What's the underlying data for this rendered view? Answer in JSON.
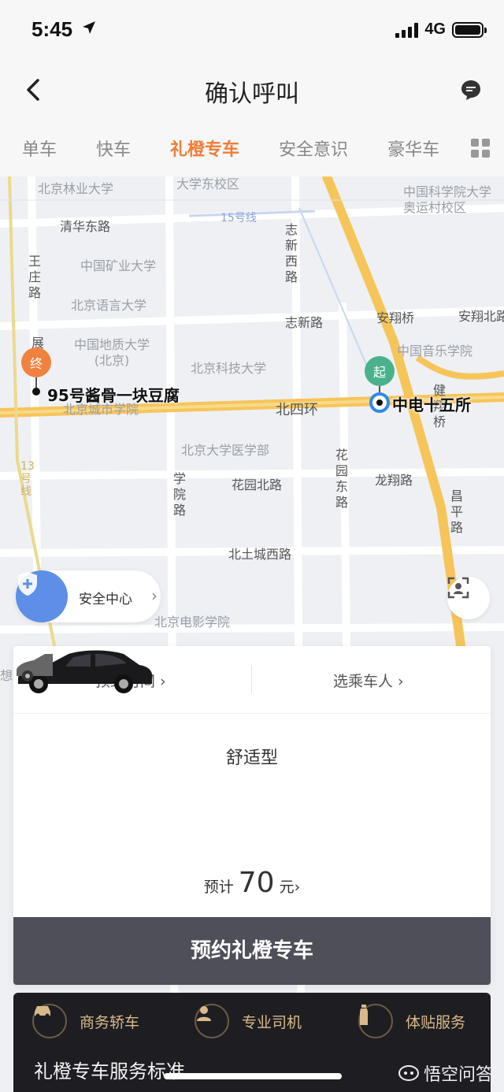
{
  "status_bar": {
    "time": "5:45",
    "network": "4G"
  },
  "header": {
    "title": "确认呼叫"
  },
  "tabs": [
    {
      "label": "单车"
    },
    {
      "label": "快车"
    },
    {
      "label": "礼橙专车"
    },
    {
      "label": "安全意识"
    },
    {
      "label": "豪华车"
    }
  ],
  "map": {
    "labels": {
      "bjly": "北京林业大学",
      "dxdx": "大学东校区",
      "zgkx": "中国科学院大学奥运村校区",
      "qhdl": "清华东路",
      "line15": "15号线",
      "zxxl": "志新西路",
      "wzl": "王庄路",
      "kydx": "中国矿业大学",
      "yydx": "北京语言大学",
      "zxl": "志新路",
      "axq": "安翔桥",
      "axbl": "安翔北路",
      "dzdx": "中国地质大学(北京)",
      "kjdx": "北京科技大学",
      "yyxy": "中国音乐学院",
      "zhan": "展",
      "csxy": "北京城市学院",
      "bsh": "北四环",
      "jxq": "健翔桥",
      "ykb": "北京大学医学部",
      "hydl": "花园东路",
      "line13": "13号线",
      "xyl": "学院路",
      "hybl": "花园北路",
      "lxl": "龙翔路",
      "cpl": "昌平路",
      "btcxl": "北土城西路",
      "dyxy": "北京电影学院",
      "xiang": "想"
    },
    "end_marker": "终",
    "start_marker": "起",
    "end_place": "95号酱骨一块豆腐",
    "start_place": "中电十五所",
    "safety_label": "安全中心"
  },
  "booking": {
    "schedule_label": "预约时间",
    "rider_label": "选乘车人",
    "car_type": "舒适型",
    "price_prefix": "预计",
    "price_value": "70",
    "price_unit": "元",
    "book_button": "预约礼橙专车"
  },
  "services": {
    "items": [
      {
        "label": "商务轿车",
        "icon": "car-icon"
      },
      {
        "label": "专业司机",
        "icon": "driver-icon"
      },
      {
        "label": "体贴服务",
        "icon": "water-bottle-icon"
      }
    ],
    "title": "礼橙专车服务标准"
  },
  "watermark": "悟空问答",
  "colors": {
    "accent": "#f07d36",
    "button": "#4f4f5a",
    "start": "#49b28d",
    "end": "#f0823f",
    "gold": "#d8b98a"
  }
}
